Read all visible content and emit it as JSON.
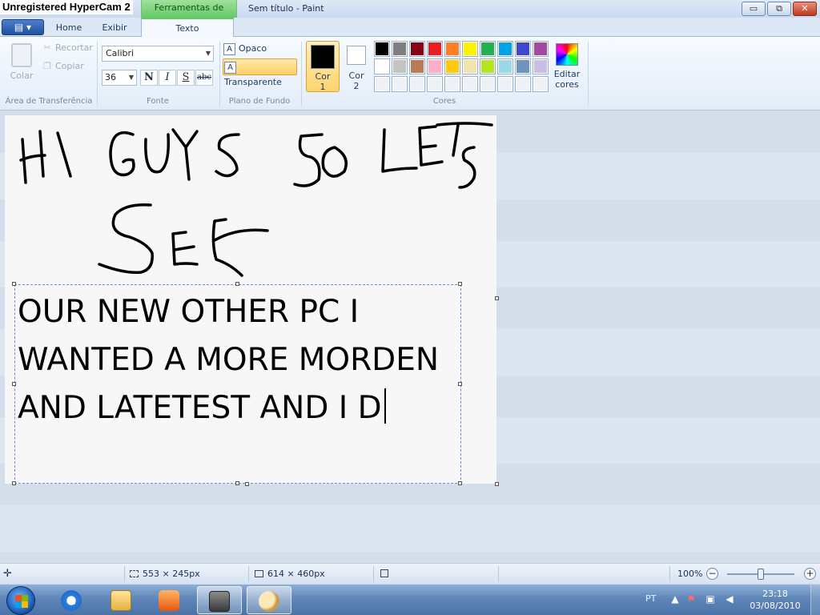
{
  "window": {
    "recorder_watermark": "Unregistered HyperCam 2",
    "contextual_tab_header": "Ferramentas de Texto",
    "title": "Sem título - Paint",
    "controls": {
      "minimize": "▭",
      "maximize": "⧉",
      "close": "✕"
    }
  },
  "tabs": {
    "app_menu": "▤ ▾",
    "home": "Home",
    "view": "Exibir",
    "text": "Texto",
    "help": "?"
  },
  "ribbon": {
    "clipboard": {
      "group_label": "Área de Transferência",
      "paste": "Colar",
      "cut": "Recortar",
      "copy": "Copiar"
    },
    "font": {
      "group_label": "Fonte",
      "family": "Calibri",
      "size": "36",
      "bold": "N",
      "italic": "I",
      "underline": "S",
      "strikethrough": "abc"
    },
    "background": {
      "group_label": "Plano de Fundo",
      "opaque": "Opaco",
      "transparent": "Transparente",
      "selected": "transparent"
    },
    "colors": {
      "group_label": "Cores",
      "color1_label": "Cor",
      "color1_num": "1",
      "color2_label": "Cor",
      "color2_num": "2",
      "color1": "#000000",
      "color2": "#ffffff",
      "edit_colors_line1": "Editar",
      "edit_colors_line2": "cores",
      "palette_row1": [
        "#000000",
        "#7f7f7f",
        "#880015",
        "#ed1c24",
        "#ff7f27",
        "#fff200",
        "#22b14c",
        "#00a2e8",
        "#3f48cc",
        "#a349a4"
      ],
      "palette_row2": [
        "#ffffff",
        "#c3c3c3",
        "#b97a57",
        "#ffaec9",
        "#ffc90e",
        "#efe4b0",
        "#b5e61d",
        "#99d9ea",
        "#7092be",
        "#c8bfe7"
      ],
      "palette_row3_empty": 10
    }
  },
  "canvas": {
    "handwritten_line1": "HI GUYS SO LETS",
    "handwritten_line2": "SEE",
    "textbox_lines": [
      "OUR NEW OTHER PC I",
      "WANTED A MORE MORDEN",
      "AND LATETEST AND I D"
    ]
  },
  "statusbar": {
    "move_icon": "✛",
    "selection_size": "553 × 245px",
    "canvas_size": "614 × 460px",
    "zoom": "100%",
    "zoom_out": "−",
    "zoom_in": "+",
    "zoom_level": 1.0
  },
  "taskbar": {
    "ie_glyph": "e",
    "language": "PT",
    "time": "23:18",
    "date": "03/08/2010"
  }
}
